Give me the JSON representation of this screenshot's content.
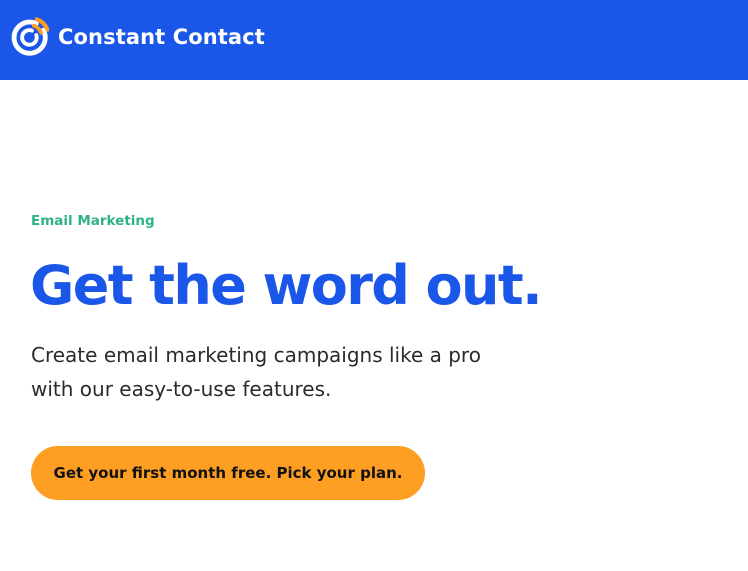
{
  "header": {
    "brand_name": "Constant Contact",
    "background_color": "#1a57e8",
    "logo_icon": "constant-contact-logo-icon",
    "logo_colors": {
      "ring": "#ffffff",
      "accent": "#fe9e22"
    }
  },
  "hero": {
    "eyebrow": "Email Marketing",
    "eyebrow_color": "#30b287",
    "headline": "Get the word out.",
    "headline_color": "#1a57e8",
    "subhead_line1": "Create email marketing campaigns like a pro",
    "subhead_line2": "with our easy-to-use features.",
    "cta_label": "Get your first month free. Pick your plan.",
    "cta_color": "#fe9e22"
  }
}
